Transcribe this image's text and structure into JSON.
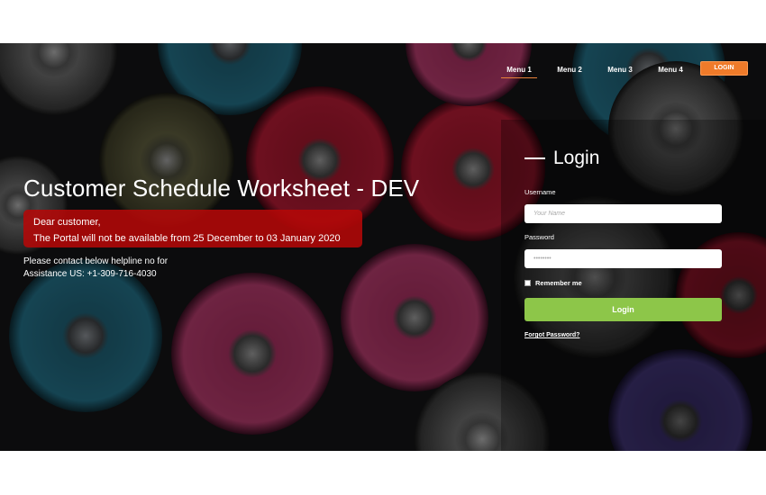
{
  "nav": {
    "items": [
      {
        "label": "Menu 1",
        "active": true
      },
      {
        "label": "Menu 2",
        "active": false
      },
      {
        "label": "Menu 3",
        "active": false
      },
      {
        "label": "Menu 4",
        "active": false
      }
    ],
    "login_button": "LOGIN"
  },
  "main": {
    "title": "Customer Schedule Worksheet - DEV",
    "alert": {
      "line1": "Dear customer,",
      "line2": "The Portal will not be available from 25 December to 03 January 2020"
    },
    "helpline": {
      "line1": "Please contact below helpline no for",
      "line2": "Assistance  US: +1-309-716-4030"
    }
  },
  "login": {
    "title": "Login",
    "username_label": "Username",
    "username_placeholder": "Your Name",
    "password_label": "Password",
    "password_placeholder": "••••••••",
    "remember_label": "Remember me",
    "submit_label": "Login",
    "forgot_label": "Forgot Password?"
  },
  "colors": {
    "accent": "#ef7b2a",
    "login_button": "#8dc649",
    "alert": "#b40808"
  }
}
